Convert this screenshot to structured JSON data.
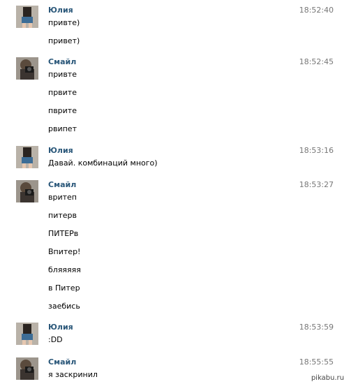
{
  "colors": {
    "author": "#2b587a",
    "time": "#777777",
    "text": "#000000"
  },
  "messages": [
    {
      "author": "Юлия",
      "avatar": "avatar-yulia",
      "time": "18:52:40",
      "lines": [
        "привте)",
        "привет)"
      ]
    },
    {
      "author": "Смайл",
      "avatar": "avatar-smile",
      "time": "18:52:45",
      "lines": [
        "привте",
        "првите",
        "пврите",
        "рвипет"
      ]
    },
    {
      "author": "Юлия",
      "avatar": "avatar-yulia",
      "time": "18:53:16",
      "lines": [
        "Давай. комбинаций много)"
      ]
    },
    {
      "author": "Смайл",
      "avatar": "avatar-smile",
      "time": "18:53:27",
      "lines": [
        "вритеп",
        "питерв",
        "ПИТЕРв",
        "Впитер!",
        "бляяяяя",
        "в Питер",
        "заебись"
      ]
    },
    {
      "author": "Юлия",
      "avatar": "avatar-yulia",
      "time": "18:53:59",
      "lines": [
        ":DD"
      ]
    },
    {
      "author": "Смайл",
      "avatar": "avatar-smile",
      "time": "18:55:55",
      "lines": [
        "я заскринил"
      ]
    }
  ],
  "watermark": "pikabu.ru"
}
